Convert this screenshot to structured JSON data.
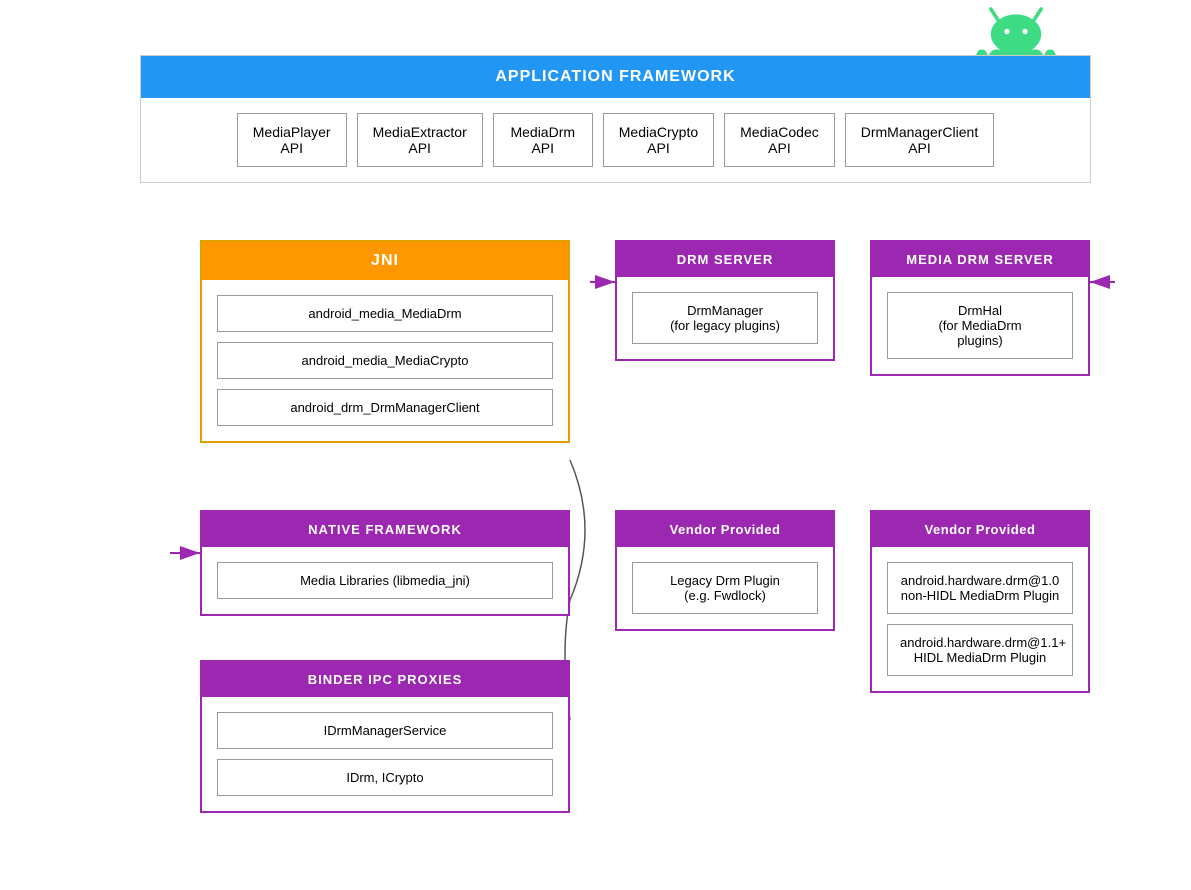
{
  "android_icon": {
    "alt": "Android Robot"
  },
  "app_framework": {
    "header": "APPLICATION FRAMEWORK",
    "apis": [
      {
        "label": "MediaPlayer\nAPI"
      },
      {
        "label": "MediaExtractor\nAPI"
      },
      {
        "label": "MediaDrm\nAPI"
      },
      {
        "label": "MediaCrypto\nAPI"
      },
      {
        "label": "MediaCodec\nAPI"
      },
      {
        "label": "DrmManagerClient\nAPI"
      }
    ]
  },
  "jni": {
    "header": "JNI",
    "items": [
      "android_media_MediaDrm",
      "android_media_MediaCrypto",
      "android_drm_DrmManagerClient"
    ]
  },
  "drm_server": {
    "header": "DRM SERVER",
    "items": [
      "DrmManager\n(for legacy plugins)"
    ]
  },
  "media_drm_server": {
    "header": "MEDIA DRM SERVER",
    "items": [
      "DrmHal\n(for MediaDrm\nplugins)"
    ]
  },
  "native_framework": {
    "header": "NATIVE FRAMEWORK",
    "items": [
      "Media Libraries (libmedia_jni)"
    ]
  },
  "vendor_left": {
    "header": "Vendor Provided",
    "items": [
      "Legacy Drm Plugin\n(e.g. Fwdlock)"
    ]
  },
  "vendor_right": {
    "header": "Vendor Provided",
    "items": [
      "android.hardware.drm@1.0\nnon-HIDL MediaDrm Plugin",
      "android.hardware.drm@1.1+\nHIDL MediaDrm Plugin"
    ]
  },
  "binder_ipc": {
    "header": "BINDER IPC PROXIES",
    "items": [
      "IDrmManagerService",
      "IDrm, ICrypto"
    ]
  },
  "colors": {
    "app_framework_bg": "#2196F3",
    "jni_bg": "#FF9800",
    "purple_bg": "#9C27B0",
    "white": "#ffffff",
    "border_gray": "#999999"
  }
}
